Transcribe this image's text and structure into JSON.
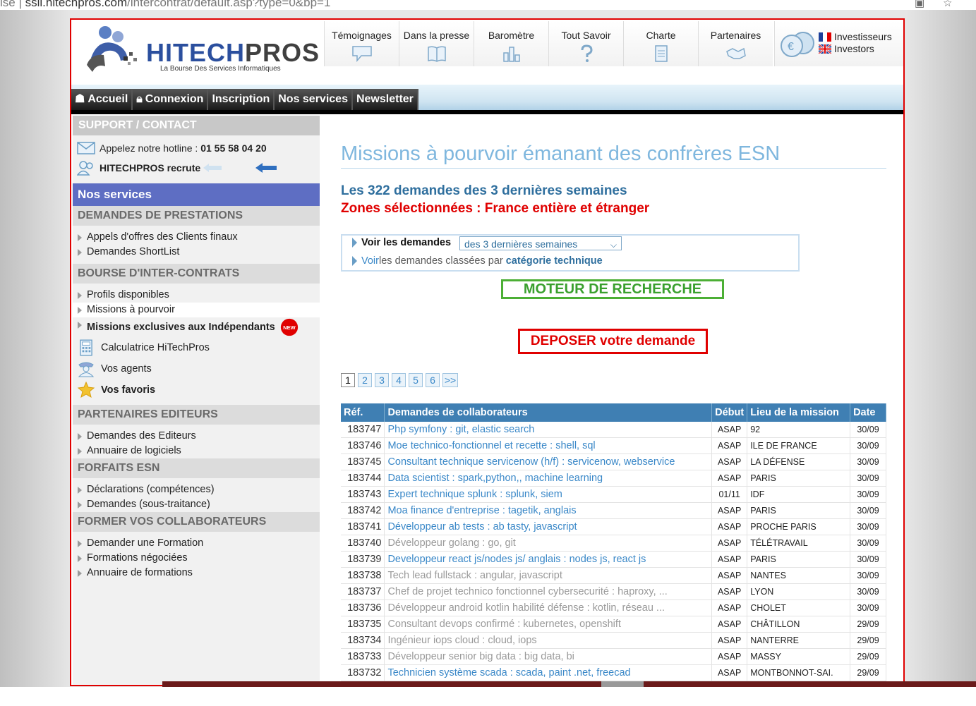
{
  "browser": {
    "url_left": "ise",
    "url_host": "ssii.hitechpros.com",
    "url_path": "/intercontrat/default.asp?type=0&bp=1"
  },
  "header": {
    "logo_text_a": "HITECH",
    "logo_text_b": "PROS",
    "logo_tagline": "La Bourse Des Services Informatiques",
    "topnav": [
      {
        "label": "Témoignages",
        "icon": "speech-bubble-icon"
      },
      {
        "label": "Dans la presse",
        "icon": "book-icon"
      },
      {
        "label": "Baromètre",
        "icon": "bar-chart-icon"
      },
      {
        "label": "Tout Savoir",
        "icon": "question-icon"
      },
      {
        "label": "Charte",
        "icon": "document-icon"
      },
      {
        "label": "Partenaires",
        "icon": "handshake-icon"
      }
    ],
    "investors_fr": "Investisseurs",
    "investors_en": "Investors"
  },
  "navbar": [
    "Accueil",
    "Connexion",
    "Inscription",
    "Nos services",
    "Newsletter"
  ],
  "sidebar": {
    "support_title": "SUPPORT / CONTACT",
    "hotline_label": "Appelez notre hotline : ",
    "hotline_number": "01 55 58 04 20",
    "recrute": "HITECHPROS recrute",
    "services_title": "Nos services",
    "s1_title": "DEMANDES DE PRESTATIONS",
    "s1_items": [
      "Appels d'offres des Clients finaux",
      "Demandes ShortList"
    ],
    "s2_title": "BOURSE D'INTER-CONTRATS",
    "s2_items": [
      "Profils disponibles",
      "Missions à pourvoir",
      "Missions exclusives aux Indépendants"
    ],
    "new_badge": "NEW",
    "calc": "Calculatrice HiTechPros",
    "agents": "Vos agents",
    "favoris": "Vos favoris",
    "s3_title": "PARTENAIRES EDITEURS",
    "s3_items": [
      "Demandes des Editeurs",
      "Annuaire de logiciels"
    ],
    "s4_title": "FORFAITS ESN",
    "s4_items": [
      "Déclarations (compétences)",
      "Demandes (sous-traitance)"
    ],
    "s5_title": "FORMER VOS COLLABORATEURS",
    "s5_items": [
      "Demander une Formation",
      "Formations négociées",
      "Annuaire de formations"
    ]
  },
  "main": {
    "title": "Missions à pourvoir émanant des confrères ESN",
    "count": "Les 322 demandes des 3 dernières semaines",
    "zones": "Zones sélectionnées : France entière et étranger",
    "filter_label": "Voir les demandes",
    "filter_value": "des 3 dernières semaines",
    "filter2_a": "Voir",
    "filter2_b": " les demandes classées par",
    "filter2_c": "catégorie technique",
    "moteur": "MOTEUR DE RECHERCHE",
    "deposer": "DEPOSER votre demande",
    "pages": [
      "1",
      "2",
      "3",
      "4",
      "5",
      "6",
      ">>"
    ],
    "table": {
      "headers": [
        "Réf.",
        "Demandes de collaborateurs",
        "Début",
        "Lieu de la mission",
        "Date"
      ],
      "rows": [
        {
          "ref": "183747",
          "dem": "Php symfony : git, elastic search",
          "deb": "ASAP",
          "lieu": "92",
          "date": "30/09",
          "gray": false
        },
        {
          "ref": "183746",
          "dem": "Moe technico-fonctionnel et recette : shell, sql",
          "deb": "ASAP",
          "lieu": "ILE DE FRANCE",
          "date": "30/09",
          "gray": false
        },
        {
          "ref": "183745",
          "dem": "Consultant technique servicenow (h/f) : servicenow, webservice",
          "deb": "ASAP",
          "lieu": "LA DÉFENSE",
          "date": "30/09",
          "gray": false
        },
        {
          "ref": "183744",
          "dem": "Data scientist : spark,python,, machine learning",
          "deb": "ASAP",
          "lieu": "PARIS",
          "date": "30/09",
          "gray": false
        },
        {
          "ref": "183743",
          "dem": "Expert technique splunk : splunk, siem",
          "deb": "01/11",
          "lieu": "IDF",
          "date": "30/09",
          "gray": false
        },
        {
          "ref": "183742",
          "dem": "Moa finance d'entreprise : tagetik, anglais",
          "deb": "ASAP",
          "lieu": "PARIS",
          "date": "30/09",
          "gray": false
        },
        {
          "ref": "183741",
          "dem": "Développeur ab tests : ab tasty, javascript",
          "deb": "ASAP",
          "lieu": "PROCHE PARIS",
          "date": "30/09",
          "gray": false
        },
        {
          "ref": "183740",
          "dem": "Développeur golang : go, git",
          "deb": "ASAP",
          "lieu": "TÉLÉTRAVAIL",
          "date": "30/09",
          "gray": true
        },
        {
          "ref": "183739",
          "dem": "Developpeur react js/nodes js/ anglais : nodes js, react js",
          "deb": "ASAP",
          "lieu": "PARIS",
          "date": "30/09",
          "gray": false
        },
        {
          "ref": "183738",
          "dem": "Tech lead fullstack : angular, javascript",
          "deb": "ASAP",
          "lieu": "NANTES",
          "date": "30/09",
          "gray": true
        },
        {
          "ref": "183737",
          "dem": "Chef de projet technico fonctionnel cybersecurité : haproxy, ...",
          "deb": "ASAP",
          "lieu": "LYON",
          "date": "30/09",
          "gray": true
        },
        {
          "ref": "183736",
          "dem": "Développeur android kotlin habilité défense : kotlin, réseau ...",
          "deb": "ASAP",
          "lieu": "CHOLET",
          "date": "30/09",
          "gray": true
        },
        {
          "ref": "183735",
          "dem": "Consultant devops confirmé : kubernetes, openshift",
          "deb": "ASAP",
          "lieu": "CHÂTILLON",
          "date": "29/09",
          "gray": true
        },
        {
          "ref": "183734",
          "dem": "Ingénieur iops cloud : cloud, iops",
          "deb": "ASAP",
          "lieu": "NANTERRE",
          "date": "29/09",
          "gray": true
        },
        {
          "ref": "183733",
          "dem": "Développeur senior big data : big data, bi",
          "deb": "ASAP",
          "lieu": "MASSY",
          "date": "29/09",
          "gray": true
        },
        {
          "ref": "183732",
          "dem": "Technicien système scada : scada, paint .net, freecad",
          "deb": "ASAP",
          "lieu": "MONTBONNOT-SAI.",
          "date": "29/09",
          "gray": false
        }
      ]
    }
  },
  "colors": {
    "brand_blue": "#2b4f9e",
    "link": "#3a88c8",
    "red": "#e00000",
    "green": "#4caf35",
    "table_head": "#3f7fb3",
    "services": "#5e6ec3"
  }
}
